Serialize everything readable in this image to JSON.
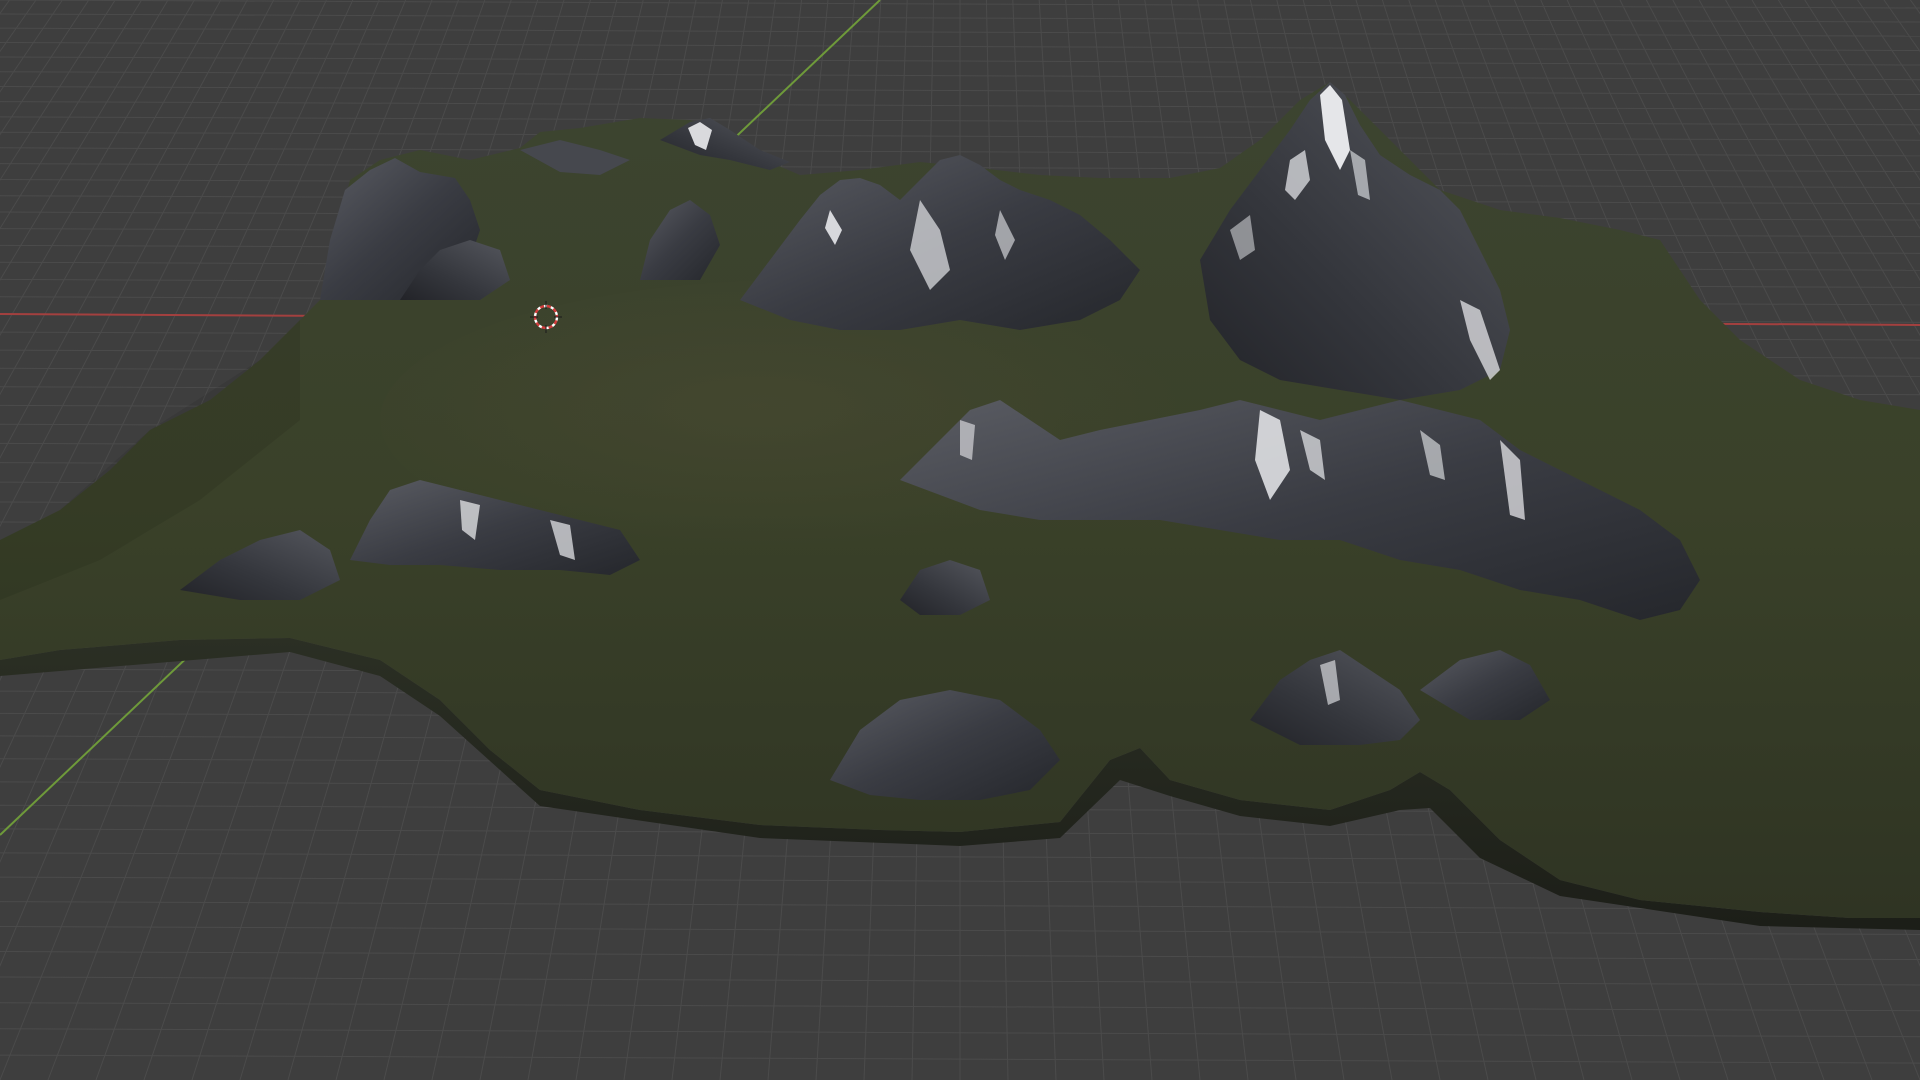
{
  "viewport": {
    "view": "perspective",
    "shading": "material-preview",
    "background_color": "#3e3e3e",
    "grid_color": "#4b4b4b",
    "x_axis_color": "#a3403f",
    "y_axis_color": "#6e9a3a"
  },
  "scene": {
    "object": "landscape-terrain",
    "materials": {
      "grass_color": "#3a422b",
      "rock_color": "#3b3d44",
      "snow_color": "#e8e9ec"
    },
    "cursor_icon": "3d-cursor-icon"
  }
}
